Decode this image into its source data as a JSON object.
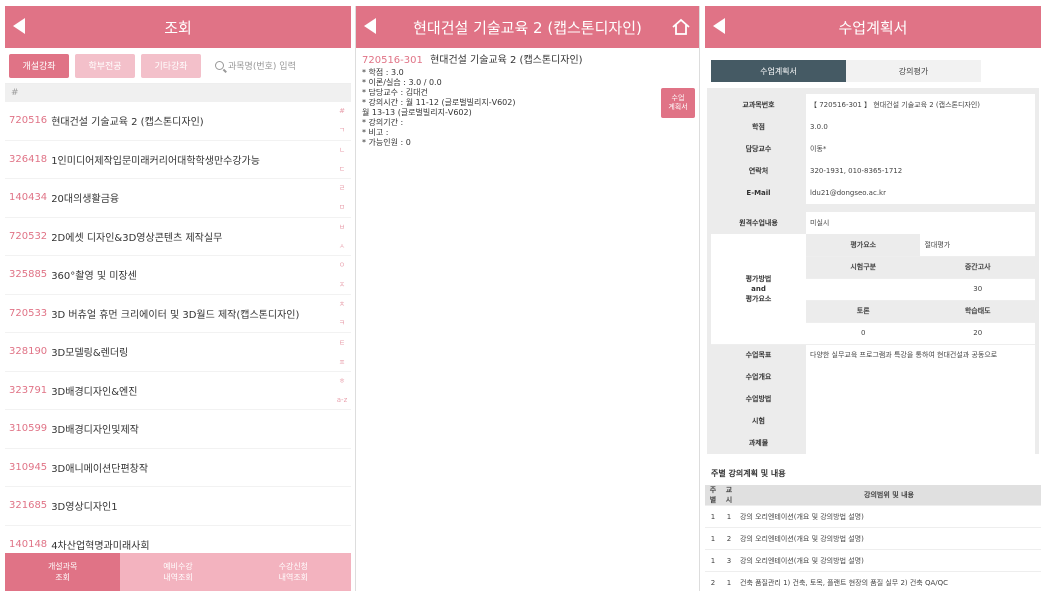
{
  "panel1": {
    "header_title": "조회",
    "filters": [
      "개설강좌",
      "학부전공",
      "기타강좌"
    ],
    "search_placeholder": "과목명(번호) 입력",
    "hash": "#",
    "courses": [
      {
        "code": "720516",
        "name": "현대건설 기술교육 2 (캡스톤디자인)"
      },
      {
        "code": "326418",
        "name": "1인미디어제작입문미래커리어대학학생만수강가능"
      },
      {
        "code": "140434",
        "name": "20대의생활금융"
      },
      {
        "code": "720532",
        "name": "2D에셋 디자인&3D영상콘텐츠 제작실무"
      },
      {
        "code": "325885",
        "name": "360°촬영 및 미장센"
      },
      {
        "code": "720533",
        "name": "3D 버츄얼 휴먼 크리에이터 및 3D월드 제작(캡스톤디자인)"
      },
      {
        "code": "328190",
        "name": "3D모델링&렌더링"
      },
      {
        "code": "323791",
        "name": "3D배경디자인&엔진"
      },
      {
        "code": "310599",
        "name": "3D배경디자인및제작"
      },
      {
        "code": "310945",
        "name": "3D애니메이션단편창작"
      },
      {
        "code": "321685",
        "name": "3D영상디자인1"
      },
      {
        "code": "140148",
        "name": "4차산업혁명과미래사회"
      }
    ],
    "index_letters": [
      "#",
      "ㄱ",
      "ㄴ",
      "ㄷ",
      "ㄹ",
      "ㅁ",
      "ㅂ",
      "ㅅ",
      "ㅇ",
      "ㅈ",
      "ㅊ",
      "ㅋ",
      "ㅌ",
      "ㅍ",
      "ㅎ",
      "a-z"
    ],
    "tabs": [
      {
        "line1": "개설과목",
        "line2": "조회"
      },
      {
        "line1": "예비수강",
        "line2": "내역조회"
      },
      {
        "line1": "수강신청",
        "line2": "내역조회"
      }
    ]
  },
  "panel2": {
    "header_title": "현대건설 기술교육 2 (캡스톤디자인)",
    "course_code": "720516-301",
    "course_name": "현대건설 기술교육 2 (캡스톤디자인)",
    "lines": [
      "* 학점 : 3.0",
      "* 이론/실습 : 3.0 / 0.0",
      "* 담당교수 : 김대건",
      "* 강의시간 : 월 11-12 (글로벌빌리지-V602)",
      "월 13-13 (글로벌빌리지-V602)",
      "* 강의기간 :",
      "* 비고 :",
      "* 가능인원 : 0"
    ],
    "plan_button": {
      "line1": "수업",
      "line2": "계획서"
    }
  },
  "panel3": {
    "header_title": "수업계획서",
    "tabs": [
      "수업계획서",
      "강의평가"
    ],
    "info": [
      {
        "label": "교과목번호",
        "value": "【 720516-301 】 현대건설 기술교육 2 (캡스톤디자인)"
      },
      {
        "label": "학점",
        "value": "3.0.0"
      },
      {
        "label": "담당교수",
        "value": "이동*"
      },
      {
        "label": "연락처",
        "value": "320-1931, 010-8365-1712"
      },
      {
        "label": "E-Mail",
        "value": "ldu21@dongseo.ac.kr"
      }
    ],
    "eval": {
      "online_label": "원격수업내용",
      "online_value": "미실시",
      "method_label_1": "평가방법",
      "method_label_2": "and",
      "method_label_3": "평가요소",
      "element_label": "평가요소",
      "element_value": "절대평가",
      "exam_label": "시험구분",
      "midterm_label": "중간고사",
      "midterm_value": "30",
      "discussion_label": "토론",
      "attitude_label": "학습태도",
      "discussion_value": "0",
      "attitude_value": "20"
    },
    "more": [
      {
        "label": "수업목표",
        "value": "다양한 실무교육 프로그램과 특강을 통하여 현대건설과 공동으로"
      },
      {
        "label": "수업개요",
        "value": ""
      },
      {
        "label": "수업방법",
        "value": ""
      },
      {
        "label": "시험",
        "value": ""
      },
      {
        "label": "과제물",
        "value": ""
      }
    ],
    "weekly_title": "주별 강의계획 및 내용",
    "weekly_headers": [
      "주별",
      "교시",
      "강의범위 및 내용"
    ],
    "weekly": [
      {
        "week": "1",
        "period": "1",
        "content": "강의 오리엔테이션(개요 및 강의방법 설명)"
      },
      {
        "week": "1",
        "period": "2",
        "content": "강의 오리엔테이션(개요 및 강의방법 설명)"
      },
      {
        "week": "1",
        "period": "3",
        "content": "강의 오리엔테이션(개요 및 강의방법 설명)"
      },
      {
        "week": "2",
        "period": "1",
        "content": "건축 품질관리 1) 건축, 토목, 플랜트 현장의 품질 실무 2) 건축 QA/QC"
      }
    ]
  }
}
